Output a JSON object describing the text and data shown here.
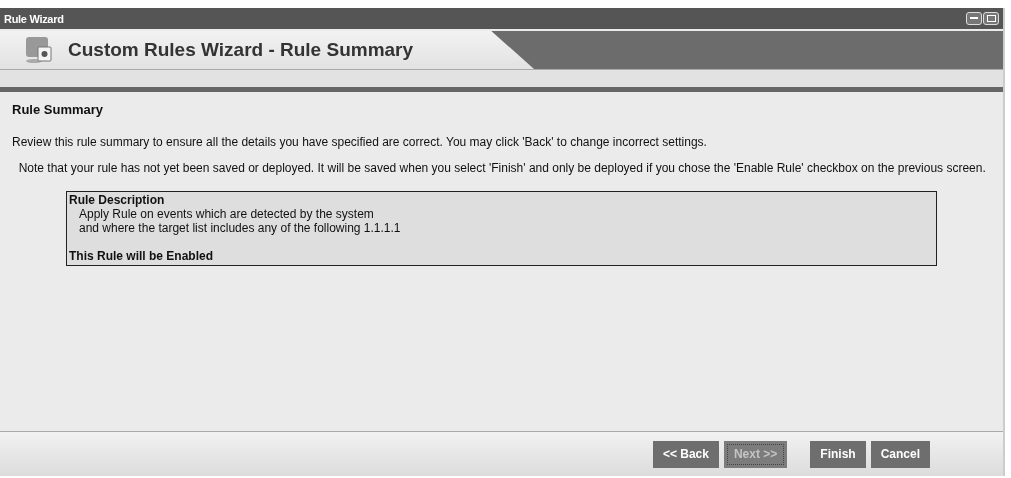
{
  "window": {
    "title": "Rule Wizard"
  },
  "header": {
    "title": "Custom Rules Wizard - Rule Summary"
  },
  "section": {
    "title": "Rule Summary"
  },
  "paragraphs": [
    "Review this rule summary to ensure all the details you have specified are correct. You may click 'Back' to change incorrect settings.",
    "  Note that your rule has not yet been saved or deployed. It will be saved when you select 'Finish' and only be deployed if you chose the 'Enable Rule' checkbox on the previous screen."
  ],
  "description": {
    "title": "Rule Description",
    "lines": [
      "Apply Rule on events which are detected by the system",
      "and where the target list includes any of the following 1.1.1.1"
    ],
    "status": "This Rule will be Enabled"
  },
  "buttons": [
    {
      "label": "<< Back",
      "disabled": false
    },
    {
      "label": "Next >>",
      "disabled": true
    },
    {
      "label": "Finish",
      "disabled": false
    },
    {
      "label": "Cancel",
      "disabled": false
    }
  ]
}
